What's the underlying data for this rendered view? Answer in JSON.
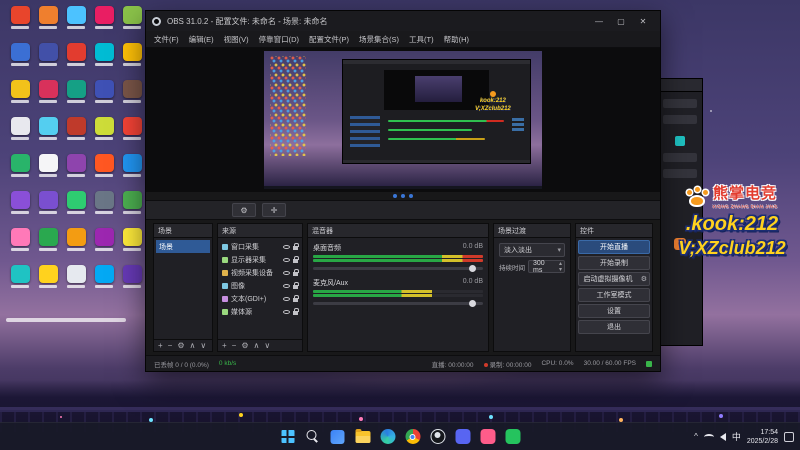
{
  "watermark": {
    "brand": "熊掌电竞",
    "brand_sub": "XIONG ZHANG DIAN JING",
    "kook": ".kook:212",
    "wechat": "V;XZclub212"
  },
  "desktop": {
    "icon_colors": [
      "#e8452c",
      "#3b6fd4",
      "#f2c21a",
      "#e8e8ee",
      "#29b46a",
      "#8a4fd8",
      "#ff79b8",
      "#1fc3c3",
      "#ef7f2e",
      "#4250a8",
      "#d8315b",
      "#54cef0",
      "#f5f5f7",
      "#7a4fd0",
      "#2aa84f",
      "#ffd21e",
      "#4cc2ff",
      "#e23c2f",
      "#15a085",
      "#bf3a2b",
      "#8e44ad",
      "#2ecc71",
      "#f39c12",
      "#e6e9ef",
      "#e91e63",
      "#00bcd4",
      "#3f51b5",
      "#cddc39",
      "#ff5722",
      "#6a7686",
      "#9c27b0",
      "#03a9f4",
      "#8bc34a",
      "#ffc107",
      "#7a5548",
      "#f44336",
      "#2196f3",
      "#4caf50",
      "#ffeb3b",
      "#673ab7"
    ]
  },
  "obs": {
    "title": "OBS 31.0.2 - 配置文件: 未命名 - 场景: 未命名",
    "win_min": "—",
    "win_max": "▢",
    "win_close": "✕",
    "menu": [
      "文件(F)",
      "编辑(E)",
      "视图(V)",
      "停靠窗口(D)",
      "配置文件(P)",
      "场景集合(S)",
      "工具(T)",
      "帮助(H)"
    ],
    "preview": {
      "wm_line1": "kook:212",
      "wm_line2": "V;XZclub212"
    },
    "toolstrip": {
      "btn1": "⚙",
      "btn2": "✛"
    },
    "scenes": {
      "title": "场景",
      "selected": "场景"
    },
    "sources": {
      "title": "来源",
      "items": [
        {
          "label": "窗口采集",
          "c": "#7ec8e3"
        },
        {
          "label": "显示器采集",
          "c": "#9ad97f"
        },
        {
          "label": "视频采集设备",
          "c": "#e0b34c"
        },
        {
          "label": "图像",
          "c": "#7ec8e3"
        },
        {
          "label": "文本(GDI+)",
          "c": "#c78fe0"
        },
        {
          "label": "媒体源",
          "c": "#9ad97f"
        }
      ]
    },
    "mixer": {
      "title": "混音器",
      "channels": [
        {
          "name": "桌面音频",
          "db": "0.0 dB"
        },
        {
          "name": "麦克风/Aux",
          "db": "0.0 dB"
        }
      ]
    },
    "transitions": {
      "title": "场景过渡",
      "selected": "淡入淡出",
      "duration_label": "持续时间",
      "duration": "300 ms"
    },
    "controls": {
      "title": "控件",
      "buttons": [
        {
          "label": "开始直播",
          "cls": "primary"
        },
        {
          "label": "开始录制"
        },
        {
          "label": "启动虚拟摄像机",
          "cls": "has-gear"
        },
        {
          "label": "工作室模式"
        },
        {
          "label": "设置"
        },
        {
          "label": "退出"
        }
      ]
    },
    "dock_tools": [
      "+",
      "−",
      "⚙",
      "∧",
      "∨"
    ],
    "status": {
      "dropped": "已丢帧 0 / 0 (0.0%)",
      "bitrate": "0 kb/s",
      "live": "直播: 00:00:00",
      "rec": "录制: 00:00:00",
      "cpu": "CPU: 0.0%",
      "fps": "30.00 / 60.00 FPS"
    }
  },
  "taskbar": {
    "lang": "中",
    "time": "17:54",
    "date": "2025/2/28"
  }
}
